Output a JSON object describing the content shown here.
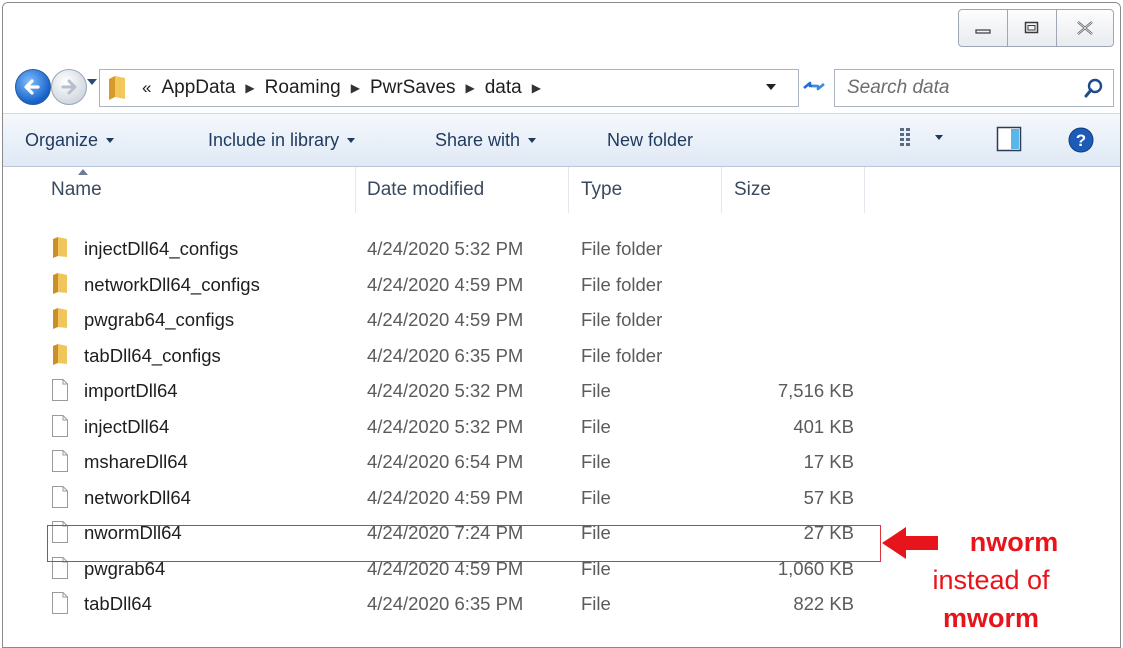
{
  "address": {
    "overflow_marker": "«",
    "breadcrumbs": [
      "AppData",
      "Roaming",
      "PwrSaves",
      "data"
    ]
  },
  "search": {
    "placeholder": "Search data"
  },
  "toolbar": {
    "organize": "Organize",
    "include_in_library": "Include in library",
    "share_with": "Share with",
    "new_folder": "New folder"
  },
  "columns": {
    "name": "Name",
    "date": "Date modified",
    "type": "Type",
    "size": "Size"
  },
  "files": [
    {
      "name": "injectDll64_configs",
      "date": "4/24/2020 5:32 PM",
      "type": "File folder",
      "size": "",
      "icon": "folder-icon"
    },
    {
      "name": "networkDll64_configs",
      "date": "4/24/2020 4:59 PM",
      "type": "File folder",
      "size": "",
      "icon": "folder-icon"
    },
    {
      "name": "pwgrab64_configs",
      "date": "4/24/2020 4:59 PM",
      "type": "File folder",
      "size": "",
      "icon": "folder-icon"
    },
    {
      "name": "tabDll64_configs",
      "date": "4/24/2020 6:35 PM",
      "type": "File folder",
      "size": "",
      "icon": "folder-icon"
    },
    {
      "name": "importDll64",
      "date": "4/24/2020 5:32 PM",
      "type": "File",
      "size": "7,516 KB",
      "icon": "file-icon"
    },
    {
      "name": "injectDll64",
      "date": "4/24/2020 5:32 PM",
      "type": "File",
      "size": "401 KB",
      "icon": "file-icon"
    },
    {
      "name": "mshareDll64",
      "date": "4/24/2020 6:54 PM",
      "type": "File",
      "size": "17 KB",
      "icon": "file-icon"
    },
    {
      "name": "networkDll64",
      "date": "4/24/2020 4:59 PM",
      "type": "File",
      "size": "57 KB",
      "icon": "file-icon"
    },
    {
      "name": "nwormDll64",
      "date": "4/24/2020 7:24 PM",
      "type": "File",
      "size": "27 KB",
      "icon": "file-icon"
    },
    {
      "name": "pwgrab64",
      "date": "4/24/2020 4:59 PM",
      "type": "File",
      "size": "1,060 KB",
      "icon": "file-icon"
    },
    {
      "name": "tabDll64",
      "date": "4/24/2020 6:35 PM",
      "type": "File",
      "size": "822 KB",
      "icon": "file-icon"
    }
  ],
  "annotation": {
    "line1": "nworm",
    "line2": "instead of",
    "line3": "mworm",
    "color": "#e8141b"
  },
  "colors": {
    "toolbar_text": "#1e3a5f",
    "highlight": "#e0323a",
    "folder": "#e8b84a"
  }
}
